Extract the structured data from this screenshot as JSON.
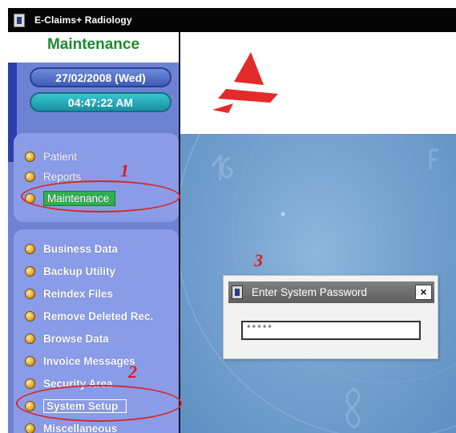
{
  "window": {
    "title": "E-Claims+ Radiology",
    "app_icon": "door-icon"
  },
  "sidebar": {
    "section_title": "Maintenance",
    "date": "27/02/2008 (Wed)",
    "time": "04:47:22 AM",
    "nav_items": [
      {
        "label": "Patient"
      },
      {
        "label": "Reports"
      },
      {
        "label": "Maintenance",
        "selected": true
      }
    ],
    "maintenance_items": [
      {
        "label": "Business Data"
      },
      {
        "label": "Backup Utility"
      },
      {
        "label": "Reindex Files"
      },
      {
        "label": "Remove Deleted Rec."
      },
      {
        "label": "Browse Data"
      },
      {
        "label": "Invoice Messages"
      },
      {
        "label": "Security Area"
      },
      {
        "label": "System Setup",
        "outlined": true
      },
      {
        "label": "Miscellaneous"
      }
    ]
  },
  "dialog": {
    "title": "Enter System Password",
    "close_label": "×",
    "password_value": "*****"
  },
  "annotations": {
    "step1": "1",
    "step2": "2",
    "step3": "3"
  },
  "colors": {
    "title_bar": "#050505",
    "sidebar": "#6e82d3",
    "panel": "#8a9ce7",
    "section_title": "#1e8a2e",
    "highlight": "#2fb04a",
    "annotation": "#d81d1d",
    "logo": "#e42a2a",
    "desktop": "#76a2cf"
  }
}
